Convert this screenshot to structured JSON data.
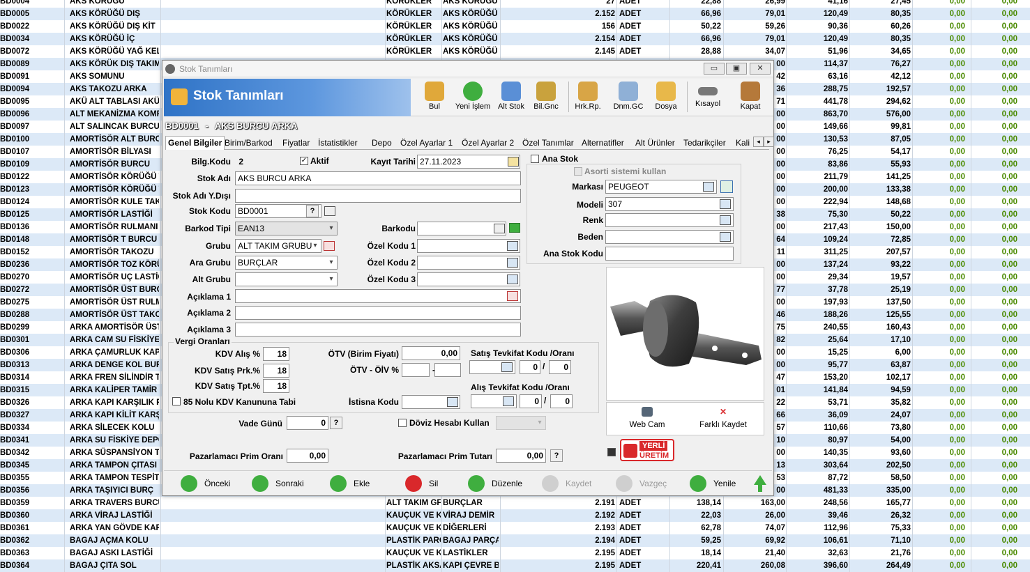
{
  "grid": {
    "rows": [
      [
        "BD0004",
        "AKS KÖRÜĞÜ",
        "KÖRÜKLER",
        "AKS KÖRÜĞÜ",
        "27",
        "ADET",
        "22,88",
        "26,99",
        "41,16",
        "27,45",
        "0,00",
        "0,00"
      ],
      [
        "BD0005",
        "AKS KÖRÜĞÜ DIŞ",
        "KÖRÜKLER",
        "AKS KÖRÜĞÜ",
        "2.152",
        "ADET",
        "66,96",
        "79,01",
        "120,49",
        "80,35",
        "0,00",
        "0,00"
      ],
      [
        "BD0022",
        "AKS KÖRÜĞÜ DIŞ KİT",
        "KÖRÜKLER",
        "AKS KÖRÜĞÜ",
        "156",
        "ADET",
        "50,22",
        "59,26",
        "90,36",
        "60,26",
        "0,00",
        "0,00"
      ],
      [
        "BD0034",
        "AKS KÖRÜĞÜ İÇ",
        "KÖRÜKLER",
        "AKS KÖRÜĞÜ",
        "2.154",
        "ADET",
        "66,96",
        "79,01",
        "120,49",
        "80,35",
        "0,00",
        "0,00"
      ],
      [
        "BD0072",
        "AKS KÖRÜĞÜ YAĞ KELE",
        "KÖRÜKLER",
        "AKS KÖRÜĞÜ",
        "2.145",
        "ADET",
        "28,88",
        "34,07",
        "51,96",
        "34,65",
        "0,00",
        "0,00"
      ],
      [
        "BD0089",
        "AKS KÖRÜK DIŞ TAKIM",
        "",
        "",
        "",
        "",
        "",
        "00",
        "114,37",
        "76,27",
        "0,00",
        "0,00"
      ],
      [
        "BD0091",
        "AKS SOMUNU",
        "",
        "",
        "",
        "",
        "",
        "42",
        "63,16",
        "42,12",
        "0,00",
        "0,00"
      ],
      [
        "BD0094",
        "AKS TAKOZU ARKA",
        "",
        "",
        "",
        "",
        "",
        "36",
        "288,75",
        "192,57",
        "0,00",
        "0,00"
      ],
      [
        "BD0095",
        "AKÜ ALT TABLASI AKÜ",
        "",
        "",
        "",
        "",
        "",
        "71",
        "441,78",
        "294,62",
        "0,00",
        "0,00"
      ],
      [
        "BD0096",
        "ALT MEKANİZMA KOMP",
        "",
        "",
        "",
        "",
        "",
        "00",
        "863,70",
        "576,00",
        "0,00",
        "0,00"
      ],
      [
        "BD0097",
        "ALT SALINCAK BURCU A",
        "",
        "",
        "",
        "",
        "",
        "00",
        "149,66",
        "99,81",
        "0,00",
        "0,00"
      ],
      [
        "BD0100",
        "AMORTİSÖR ALT BURC",
        "",
        "",
        "",
        "",
        "",
        "00",
        "130,53",
        "87,05",
        "0,00",
        "0,00"
      ],
      [
        "BD0107",
        "AMORTİSÖR BİLYASI",
        "",
        "",
        "",
        "",
        "",
        "00",
        "76,25",
        "54,17",
        "0,00",
        "0,00"
      ],
      [
        "BD0109",
        "AMORTİSÖR BURCU",
        "",
        "",
        "",
        "",
        "",
        "00",
        "83,86",
        "55,93",
        "0,00",
        "0,00"
      ],
      [
        "BD0122",
        "AMORTİSÖR KÖRÜĞÜ T",
        "",
        "",
        "",
        "",
        "",
        "00",
        "211,79",
        "141,25",
        "0,00",
        "0,00"
      ],
      [
        "BD0123",
        "AMORTİSÖR KÖRÜĞÜ T",
        "",
        "",
        "",
        "",
        "",
        "00",
        "200,00",
        "133,38",
        "0,00",
        "0,00"
      ],
      [
        "BD0124",
        "AMORTİSÖR KULE TAKC",
        "",
        "",
        "",
        "",
        "",
        "00",
        "222,94",
        "148,68",
        "0,00",
        "0,00"
      ],
      [
        "BD0125",
        "AMORTİSÖR LASTİĞİ",
        "",
        "",
        "",
        "",
        "",
        "38",
        "75,30",
        "50,22",
        "0,00",
        "0,00"
      ],
      [
        "BD0136",
        "AMORTİSÖR RULMANI",
        "",
        "",
        "",
        "",
        "",
        "00",
        "217,43",
        "150,00",
        "0,00",
        "0,00"
      ],
      [
        "BD0148",
        "AMORTİSÖR T BURCU",
        "",
        "",
        "",
        "",
        "",
        "64",
        "109,24",
        "72,85",
        "0,00",
        "0,00"
      ],
      [
        "BD0152",
        "AMORTİSÖR TAKOZU",
        "",
        "",
        "",
        "",
        "",
        "11",
        "311,25",
        "207,57",
        "0,00",
        "0,00"
      ],
      [
        "BD0236",
        "AMORTİSÖR TOZ KÖRÜ",
        "",
        "",
        "",
        "",
        "",
        "00",
        "137,24",
        "93,22",
        "0,00",
        "0,00"
      ],
      [
        "BD0270",
        "AMORTİSÖR UÇ LASTİĞ",
        "",
        "",
        "",
        "",
        "",
        "00",
        "29,34",
        "19,57",
        "0,00",
        "0,00"
      ],
      [
        "BD0272",
        "AMORTİSÖR ÜST BURC",
        "",
        "",
        "",
        "",
        "",
        "77",
        "37,78",
        "25,19",
        "0,00",
        "0,00"
      ],
      [
        "BD0275",
        "AMORTİSÖR ÜST RULM",
        "",
        "",
        "",
        "",
        "",
        "00",
        "197,93",
        "137,50",
        "0,00",
        "0,00"
      ],
      [
        "BD0288",
        "AMORTİSÖR ÜST TAKO",
        "",
        "",
        "",
        "",
        "",
        "46",
        "188,26",
        "125,55",
        "0,00",
        "0,00"
      ],
      [
        "BD0299",
        "ARKA AMORTİSÖR ÜST",
        "",
        "",
        "",
        "",
        "",
        "75",
        "240,55",
        "160,43",
        "0,00",
        "0,00"
      ],
      [
        "BD0301",
        "ARKA CAM SU FİSKİYE",
        "",
        "",
        "",
        "",
        "",
        "82",
        "25,64",
        "17,10",
        "0,00",
        "0,00"
      ],
      [
        "BD0306",
        "ARKA ÇAMURLUK KAPL",
        "",
        "",
        "",
        "",
        "",
        "00",
        "15,25",
        "6,00",
        "0,00",
        "0,00"
      ],
      [
        "BD0313",
        "ARKA DENGE KOL BURC",
        "",
        "",
        "",
        "",
        "",
        "00",
        "95,77",
        "63,87",
        "0,00",
        "0,00"
      ],
      [
        "BD0314",
        "ARKA FREN SİLİNDİR T",
        "",
        "",
        "",
        "",
        "",
        "47",
        "153,20",
        "102,17",
        "0,00",
        "0,00"
      ],
      [
        "BD0315",
        "ARKA KALİPER TAMİR",
        "",
        "",
        "",
        "",
        "",
        "01",
        "141,84",
        "94,59",
        "0,00",
        "0,00"
      ],
      [
        "BD0326",
        "ARKA KAPI KARŞILIK P",
        "",
        "",
        "",
        "",
        "",
        "22",
        "53,71",
        "35,82",
        "0,00",
        "0,00"
      ],
      [
        "BD0327",
        "ARKA KAPI KİLİT KARŞ",
        "",
        "",
        "",
        "",
        "",
        "66",
        "36,09",
        "24,07",
        "0,00",
        "0,00"
      ],
      [
        "BD0334",
        "ARKA SİLECEK KOLU",
        "",
        "",
        "",
        "",
        "",
        "57",
        "110,66",
        "73,80",
        "0,00",
        "0,00"
      ],
      [
        "BD0341",
        "ARKA SU FİSKİYE DEPO",
        "",
        "",
        "",
        "",
        "",
        "10",
        "80,97",
        "54,00",
        "0,00",
        "0,00"
      ],
      [
        "BD0342",
        "ARKA SÜSPANSİYON TA",
        "",
        "",
        "",
        "",
        "",
        "00",
        "140,35",
        "93,60",
        "0,00",
        "0,00"
      ],
      [
        "BD0345",
        "ARKA TAMPON ÇITASI",
        "",
        "",
        "",
        "",
        "",
        "13",
        "303,64",
        "202,50",
        "0,00",
        "0,00"
      ],
      [
        "BD0355",
        "ARKA TAMPON TESPİT",
        "",
        "",
        "",
        "",
        "",
        "53",
        "87,72",
        "58,50",
        "0,00",
        "0,00"
      ],
      [
        "BD0356",
        "ARKA TAŞIYICI BURÇ",
        "",
        "",
        "",
        "",
        "",
        "00",
        "481,33",
        "335,00",
        "0,00",
        "0,00"
      ],
      [
        "BD0359",
        "ARKA TRAVERS BURCU",
        "ALT TAKIM GF",
        "BURÇLAR",
        "2.191",
        "ADET",
        "138,14",
        "163,00",
        "248,56",
        "165,77",
        "0,00",
        "0,00"
      ],
      [
        "BD0360",
        "ARKA VİRAJ LASTİĞİ",
        "KAUÇUK VE KA",
        "VİRAJ DEMİR",
        "2.192",
        "ADET",
        "22,03",
        "26,00",
        "39,46",
        "26,32",
        "0,00",
        "0,00"
      ],
      [
        "BD0361",
        "ARKA YAN GÖVDE KAPI",
        "KAUÇUK VE KA",
        "DİĞERLERİ",
        "2.193",
        "ADET",
        "62,78",
        "74,07",
        "112,96",
        "75,33",
        "0,00",
        "0,00"
      ],
      [
        "BD0362",
        "BAGAJ AÇMA KOLU",
        "PLASTİK PARÇ",
        "BAGAJ PARÇA",
        "2.194",
        "ADET",
        "59,25",
        "69,92",
        "106,61",
        "71,10",
        "0,00",
        "0,00"
      ],
      [
        "BD0363",
        "BAGAJ ASKI LASTİĞİ",
        "KAUÇUK VE KA",
        "LASTİKLER",
        "2.195",
        "ADET",
        "18,14",
        "21,40",
        "32,63",
        "21,76",
        "0,00",
        "0,00"
      ],
      [
        "BD0364",
        "BAGAJ ÇITA SOL",
        "PLASTİK AKSA",
        "KAPI ÇEVRE B",
        "2.195",
        "ADET",
        "220,41",
        "260,08",
        "396,60",
        "264,49",
        "0,00",
        "0,00"
      ]
    ]
  },
  "window": {
    "title": "Stok Tanımları",
    "banner_title": "Stok Tanımları",
    "min_label": "▭",
    "max_label": "▣",
    "close_label": "✕"
  },
  "toolbar": {
    "bul": "Bul",
    "yeni": "Yeni İşlem",
    "alt_stok": "Alt Stok",
    "bil_gnc": "Bil.Gnc",
    "hrk_rp": "Hrk.Rp.",
    "dnm_gc": "Dnm.GC",
    "dosya": "Dosya",
    "kisayol": "Kısayol",
    "kapat": "Kapat"
  },
  "record": {
    "code": "BD0001",
    "dash": "-",
    "name": "AKS BURCU ARKA"
  },
  "tabs": [
    "Genel Bilgiler",
    "Birim/Barkod",
    "Fiyatlar",
    "İstatistikler",
    "Depo",
    "Özel Ayarlar 1",
    "Özel Ayarlar 2",
    "Özel Tanımlar",
    "Alternatifler",
    "Alt Ürünler",
    "Tedarikçiler",
    "Kali"
  ],
  "form": {
    "bilg_kodu_label": "Bilg.Kodu",
    "bilg_kodu_value": "2",
    "aktif_label": "Aktif",
    "kayit_tarihi_label": "Kayıt Tarihi",
    "kayit_tarihi_value": "27.11.2023",
    "stok_adi_label": "Stok Adı",
    "stok_adi_value": "AKS BURCU ARKA",
    "stok_adi_yd_label": "Stok Adı Y.Dışı",
    "stok_adi_yd_value": "",
    "stok_kodu_label": "Stok Kodu",
    "stok_kodu_value": "BD0001",
    "barkod_tipi_label": "Barkod Tipi",
    "barkod_tipi_value": "EAN13",
    "barkodu_label": "Barkodu",
    "grubu_label": "Grubu",
    "grubu_value": "ALT TAKIM GRUBU",
    "ozel1_label": "Özel Kodu 1",
    "ara_grubu_label": "Ara Grubu",
    "ara_grubu_value": "BURÇLAR",
    "ozel2_label": "Özel Kodu 2",
    "alt_grubu_label": "Alt Grubu",
    "ozel3_label": "Özel Kodu 3",
    "aciklama1_label": "Açıklama 1",
    "aciklama2_label": "Açıklama 2",
    "aciklama3_label": "Açıklama 3",
    "ana_stok_label": "Ana Stok",
    "asorti_label": "Asorti sistemi kullan",
    "markasi_label": "Markası",
    "markasi_value": "PEUGEOT",
    "modeli_label": "Modeli",
    "modeli_value": "307",
    "renk_label": "Renk",
    "beden_label": "Beden",
    "ana_stok_kodu_label": "Ana Stok Kodu",
    "vergi_title": "Vergi Oranları",
    "kdv_alis_label": "KDV Alış %",
    "kdv_alis_value": "18",
    "kdv_satis_prk_label": "KDV Satış Prk.%",
    "kdv_satis_prk_value": "18",
    "kdv_satis_tpt_label": "KDV Satış Tpt.%",
    "kdv_satis_tpt_value": "18",
    "kanun_label": "85 Nolu KDV Kanununa Tabi",
    "otv_label": "ÖTV (Birim Fiyatı)",
    "otv_value": "0,00",
    "otv_oiv_label": "ÖTV - ÖİV %",
    "istisna_label": "İstisna Kodu",
    "satis_tevk_label": "Satış Tevkifat Kodu /Oranı",
    "satis_tevk_a": "0",
    "satis_tevk_b": "0",
    "alis_tevk_label": "Alış Tevkifat Kodu /Oranı",
    "alis_tevk_a": "0",
    "alis_tevk_b": "0",
    "slash": "/",
    "vade_label": "Vade Günü",
    "vade_value": "0",
    "doviz_label": "Döviz Hesabı Kullan",
    "prim_orani_label": "Pazarlamacı Prim Oranı",
    "prim_orani_value": "0,00",
    "prim_tutari_label": "Pazarlamacı Prim Tutarı",
    "prim_tutari_value": "0,00",
    "q": "?",
    "check": "✓",
    "webcam": "Web Cam",
    "farkli_kaydet": "Farklı Kaydet",
    "yerli_line1": "YERLİ",
    "yerli_line2": "ÜRETİM"
  },
  "nav": {
    "onceki": "Önceki",
    "sonraki": "Sonraki",
    "ekle": "Ekle",
    "sil": "Sil",
    "duzenle": "Düzenle",
    "kaydet": "Kaydet",
    "vazgec": "Vazgeç",
    "yenile": "Yenile"
  },
  "colors": {
    "accent": "#2f73c6",
    "green": "#3fae3f",
    "red": "#d9282b"
  }
}
